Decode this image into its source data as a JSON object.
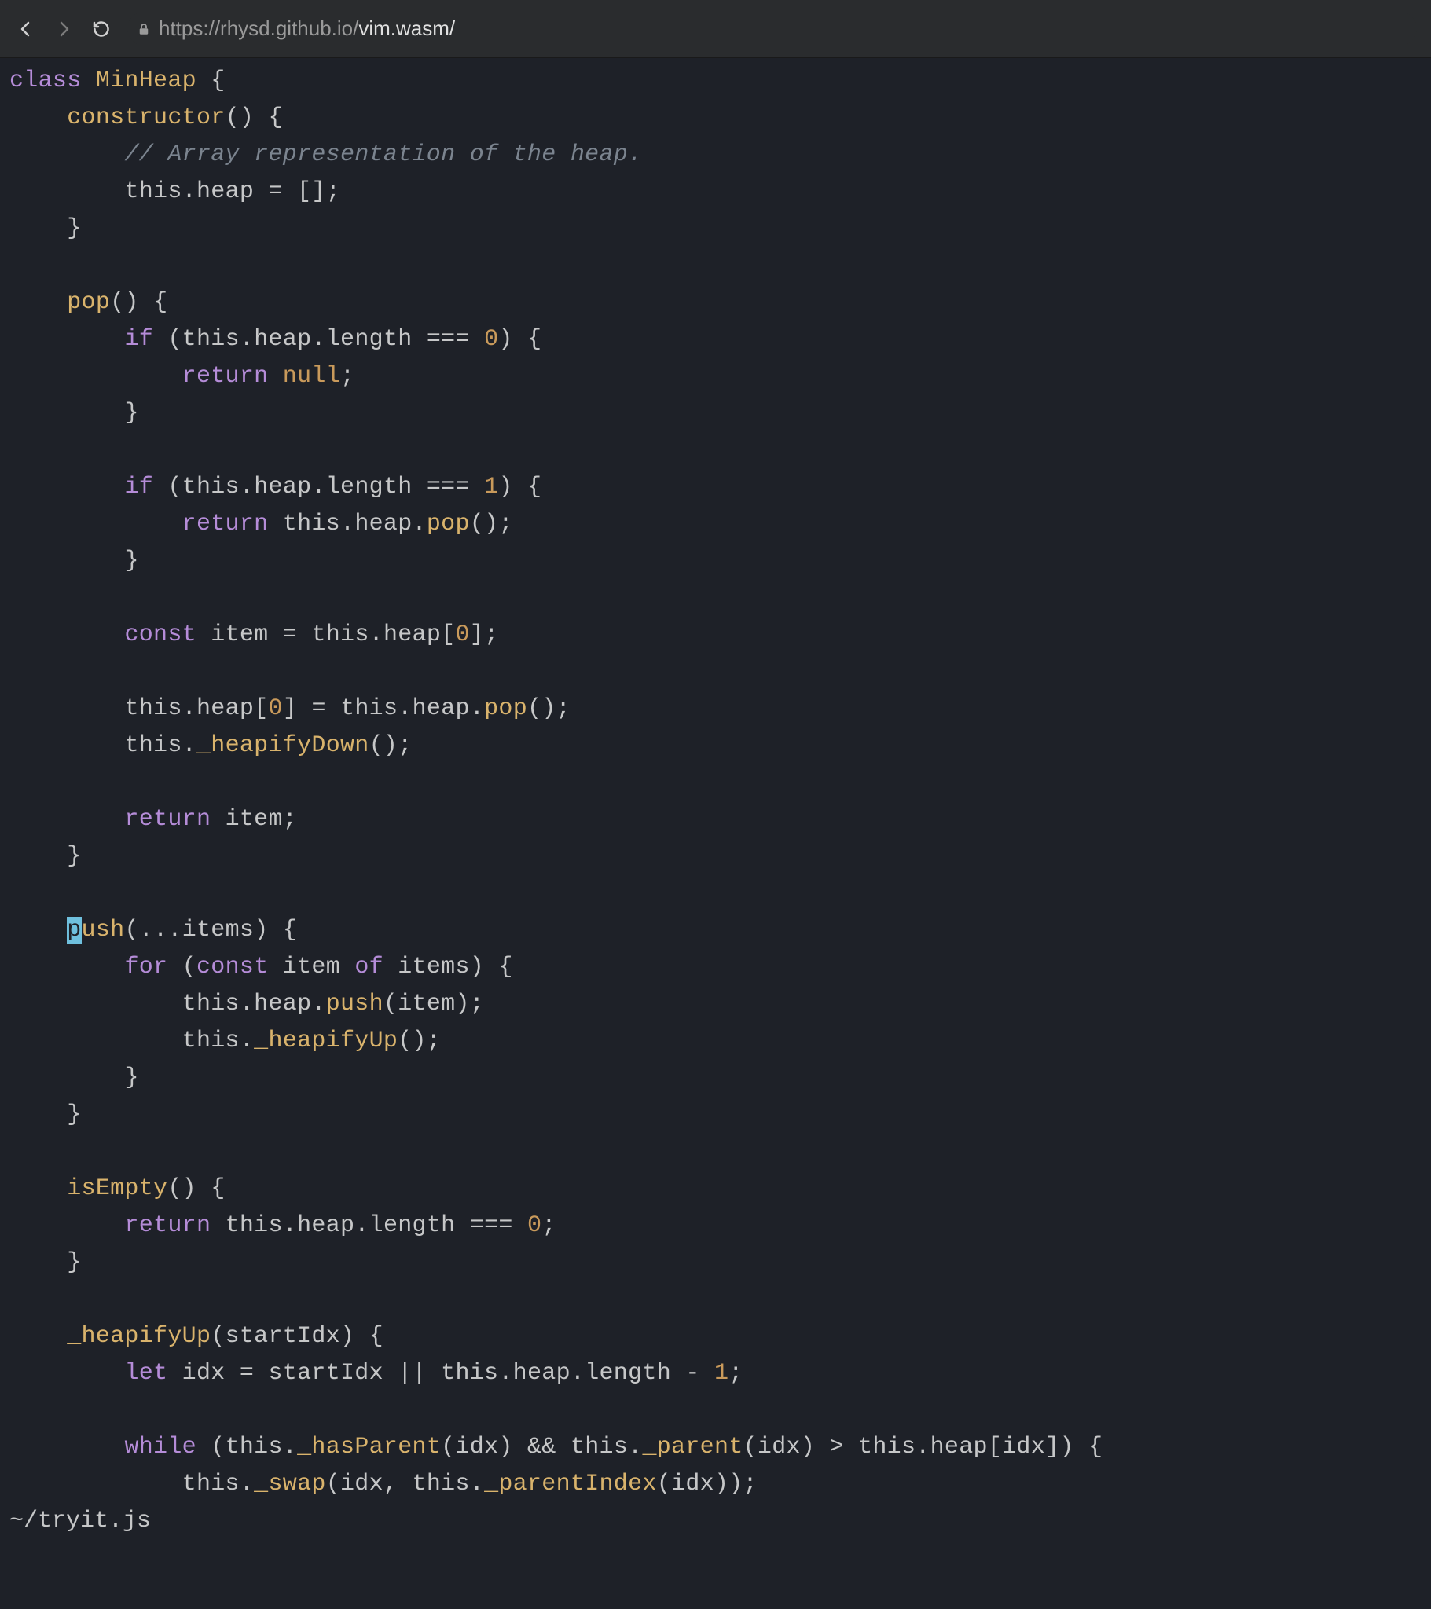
{
  "browser": {
    "url_prefix": "https://rhysd.github.io/",
    "url_highlight": "vim.wasm/"
  },
  "status_line": "~/tryit.js",
  "code": {
    "tokens": [
      [
        [
          "kw",
          "class"
        ],
        [
          "id",
          " "
        ],
        [
          "type",
          "MinHeap"
        ],
        [
          "id",
          " "
        ],
        [
          "pn",
          "{"
        ]
      ],
      [
        [
          "id",
          "    "
        ],
        [
          "fn2",
          "constructor"
        ],
        [
          "pn",
          "()"
        ],
        [
          "id",
          " "
        ],
        [
          "pn",
          "{"
        ]
      ],
      [
        [
          "id",
          "        "
        ],
        [
          "cm",
          "// Array representation of the heap."
        ]
      ],
      [
        [
          "id",
          "        "
        ],
        [
          "this",
          "this"
        ],
        [
          "op",
          "."
        ],
        [
          "id",
          "heap "
        ],
        [
          "op",
          "="
        ],
        [
          "id",
          " "
        ],
        [
          "pn",
          "[];"
        ]
      ],
      [
        [
          "id",
          "    "
        ],
        [
          "pn",
          "}"
        ]
      ],
      [
        [
          "id",
          ""
        ]
      ],
      [
        [
          "id",
          "    "
        ],
        [
          "fn2",
          "pop"
        ],
        [
          "pn",
          "()"
        ],
        [
          "id",
          " "
        ],
        [
          "pn",
          "{"
        ]
      ],
      [
        [
          "id",
          "        "
        ],
        [
          "kw",
          "if"
        ],
        [
          "id",
          " "
        ],
        [
          "pn",
          "("
        ],
        [
          "this",
          "this"
        ],
        [
          "op",
          "."
        ],
        [
          "id",
          "heap"
        ],
        [
          "op",
          "."
        ],
        [
          "id",
          "length "
        ],
        [
          "op",
          "==="
        ],
        [
          "id",
          " "
        ],
        [
          "num",
          "0"
        ],
        [
          "pn",
          ")"
        ],
        [
          "id",
          " "
        ],
        [
          "pn",
          "{"
        ]
      ],
      [
        [
          "id",
          "            "
        ],
        [
          "kw",
          "return"
        ],
        [
          "id",
          " "
        ],
        [
          "nullkw",
          "null"
        ],
        [
          "pn",
          ";"
        ]
      ],
      [
        [
          "id",
          "        "
        ],
        [
          "pn",
          "}"
        ]
      ],
      [
        [
          "id",
          ""
        ]
      ],
      [
        [
          "id",
          "        "
        ],
        [
          "kw",
          "if"
        ],
        [
          "id",
          " "
        ],
        [
          "pn",
          "("
        ],
        [
          "this",
          "this"
        ],
        [
          "op",
          "."
        ],
        [
          "id",
          "heap"
        ],
        [
          "op",
          "."
        ],
        [
          "id",
          "length "
        ],
        [
          "op",
          "==="
        ],
        [
          "id",
          " "
        ],
        [
          "num",
          "1"
        ],
        [
          "pn",
          ")"
        ],
        [
          "id",
          " "
        ],
        [
          "pn",
          "{"
        ]
      ],
      [
        [
          "id",
          "            "
        ],
        [
          "kw",
          "return"
        ],
        [
          "id",
          " "
        ],
        [
          "this",
          "this"
        ],
        [
          "op",
          "."
        ],
        [
          "id",
          "heap"
        ],
        [
          "op",
          "."
        ],
        [
          "fn2",
          "pop"
        ],
        [
          "pn",
          "();"
        ]
      ],
      [
        [
          "id",
          "        "
        ],
        [
          "pn",
          "}"
        ]
      ],
      [
        [
          "id",
          ""
        ]
      ],
      [
        [
          "id",
          "        "
        ],
        [
          "kw",
          "const"
        ],
        [
          "id",
          " item "
        ],
        [
          "op",
          "="
        ],
        [
          "id",
          " "
        ],
        [
          "this",
          "this"
        ],
        [
          "op",
          "."
        ],
        [
          "id",
          "heap"
        ],
        [
          "pn",
          "["
        ],
        [
          "num",
          "0"
        ],
        [
          "pn",
          "];"
        ]
      ],
      [
        [
          "id",
          ""
        ]
      ],
      [
        [
          "id",
          "        "
        ],
        [
          "this",
          "this"
        ],
        [
          "op",
          "."
        ],
        [
          "id",
          "heap"
        ],
        [
          "pn",
          "["
        ],
        [
          "num",
          "0"
        ],
        [
          "pn",
          "]"
        ],
        [
          "id",
          " "
        ],
        [
          "op",
          "="
        ],
        [
          "id",
          " "
        ],
        [
          "this",
          "this"
        ],
        [
          "op",
          "."
        ],
        [
          "id",
          "heap"
        ],
        [
          "op",
          "."
        ],
        [
          "fn2",
          "pop"
        ],
        [
          "pn",
          "();"
        ]
      ],
      [
        [
          "id",
          "        "
        ],
        [
          "this",
          "this"
        ],
        [
          "op",
          "."
        ],
        [
          "fn2",
          "_heapifyDown"
        ],
        [
          "pn",
          "();"
        ]
      ],
      [
        [
          "id",
          ""
        ]
      ],
      [
        [
          "id",
          "        "
        ],
        [
          "kw",
          "return"
        ],
        [
          "id",
          " item"
        ],
        [
          "pn",
          ";"
        ]
      ],
      [
        [
          "id",
          "    "
        ],
        [
          "pn",
          "}"
        ]
      ],
      [
        [
          "id",
          ""
        ]
      ],
      [
        [
          "id",
          "    "
        ],
        [
          "cursor",
          "p"
        ],
        [
          "fn2",
          "ush"
        ],
        [
          "pn",
          "("
        ],
        [
          "op",
          "..."
        ],
        [
          "id",
          "items"
        ],
        [
          "pn",
          ")"
        ],
        [
          "id",
          " "
        ],
        [
          "pn",
          "{"
        ]
      ],
      [
        [
          "id",
          "        "
        ],
        [
          "kw",
          "for"
        ],
        [
          "id",
          " "
        ],
        [
          "pn",
          "("
        ],
        [
          "kw",
          "const"
        ],
        [
          "id",
          " item "
        ],
        [
          "kw",
          "of"
        ],
        [
          "id",
          " items"
        ],
        [
          "pn",
          ")"
        ],
        [
          "id",
          " "
        ],
        [
          "pn",
          "{"
        ]
      ],
      [
        [
          "id",
          "            "
        ],
        [
          "this",
          "this"
        ],
        [
          "op",
          "."
        ],
        [
          "id",
          "heap"
        ],
        [
          "op",
          "."
        ],
        [
          "fn2",
          "push"
        ],
        [
          "pn",
          "("
        ],
        [
          "id",
          "item"
        ],
        [
          "pn",
          ");"
        ]
      ],
      [
        [
          "id",
          "            "
        ],
        [
          "this",
          "this"
        ],
        [
          "op",
          "."
        ],
        [
          "fn2",
          "_heapifyUp"
        ],
        [
          "pn",
          "();"
        ]
      ],
      [
        [
          "id",
          "        "
        ],
        [
          "pn",
          "}"
        ]
      ],
      [
        [
          "id",
          "    "
        ],
        [
          "pn",
          "}"
        ]
      ],
      [
        [
          "id",
          ""
        ]
      ],
      [
        [
          "id",
          "    "
        ],
        [
          "fn2",
          "isEmpty"
        ],
        [
          "pn",
          "()"
        ],
        [
          "id",
          " "
        ],
        [
          "pn",
          "{"
        ]
      ],
      [
        [
          "id",
          "        "
        ],
        [
          "kw",
          "return"
        ],
        [
          "id",
          " "
        ],
        [
          "this",
          "this"
        ],
        [
          "op",
          "."
        ],
        [
          "id",
          "heap"
        ],
        [
          "op",
          "."
        ],
        [
          "id",
          "length "
        ],
        [
          "op",
          "==="
        ],
        [
          "id",
          " "
        ],
        [
          "num",
          "0"
        ],
        [
          "pn",
          ";"
        ]
      ],
      [
        [
          "id",
          "    "
        ],
        [
          "pn",
          "}"
        ]
      ],
      [
        [
          "id",
          ""
        ]
      ],
      [
        [
          "id",
          "    "
        ],
        [
          "fn2",
          "_heapifyUp"
        ],
        [
          "pn",
          "("
        ],
        [
          "id",
          "startIdx"
        ],
        [
          "pn",
          ")"
        ],
        [
          "id",
          " "
        ],
        [
          "pn",
          "{"
        ]
      ],
      [
        [
          "id",
          "        "
        ],
        [
          "kw",
          "let"
        ],
        [
          "id",
          " idx "
        ],
        [
          "op",
          "="
        ],
        [
          "id",
          " startIdx "
        ],
        [
          "op",
          "||"
        ],
        [
          "id",
          " "
        ],
        [
          "this",
          "this"
        ],
        [
          "op",
          "."
        ],
        [
          "id",
          "heap"
        ],
        [
          "op",
          "."
        ],
        [
          "id",
          "length "
        ],
        [
          "op",
          "-"
        ],
        [
          "id",
          " "
        ],
        [
          "num",
          "1"
        ],
        [
          "pn",
          ";"
        ]
      ],
      [
        [
          "id",
          ""
        ]
      ],
      [
        [
          "id",
          "        "
        ],
        [
          "kw",
          "while"
        ],
        [
          "id",
          " "
        ],
        [
          "pn",
          "("
        ],
        [
          "this",
          "this"
        ],
        [
          "op",
          "."
        ],
        [
          "fn2",
          "_hasParent"
        ],
        [
          "pn",
          "("
        ],
        [
          "id",
          "idx"
        ],
        [
          "pn",
          ")"
        ],
        [
          "id",
          " "
        ],
        [
          "op",
          "&&"
        ],
        [
          "id",
          " "
        ],
        [
          "this",
          "this"
        ],
        [
          "op",
          "."
        ],
        [
          "fn2",
          "_parent"
        ],
        [
          "pn",
          "("
        ],
        [
          "id",
          "idx"
        ],
        [
          "pn",
          ")"
        ],
        [
          "id",
          " "
        ],
        [
          "op",
          ">"
        ],
        [
          "id",
          " "
        ],
        [
          "this",
          "this"
        ],
        [
          "op",
          "."
        ],
        [
          "id",
          "heap"
        ],
        [
          "pn",
          "["
        ],
        [
          "id",
          "idx"
        ],
        [
          "pn",
          "])"
        ],
        [
          "id",
          " "
        ],
        [
          "pn",
          "{"
        ]
      ],
      [
        [
          "id",
          "            "
        ],
        [
          "this",
          "this"
        ],
        [
          "op",
          "."
        ],
        [
          "fn2",
          "_swap"
        ],
        [
          "pn",
          "("
        ],
        [
          "id",
          "idx"
        ],
        [
          "pn",
          ","
        ],
        [
          "id",
          " "
        ],
        [
          "this",
          "this"
        ],
        [
          "op",
          "."
        ],
        [
          "fn2",
          "_parentIndex"
        ],
        [
          "pn",
          "("
        ],
        [
          "id",
          "idx"
        ],
        [
          "pn",
          "));"
        ]
      ]
    ]
  }
}
